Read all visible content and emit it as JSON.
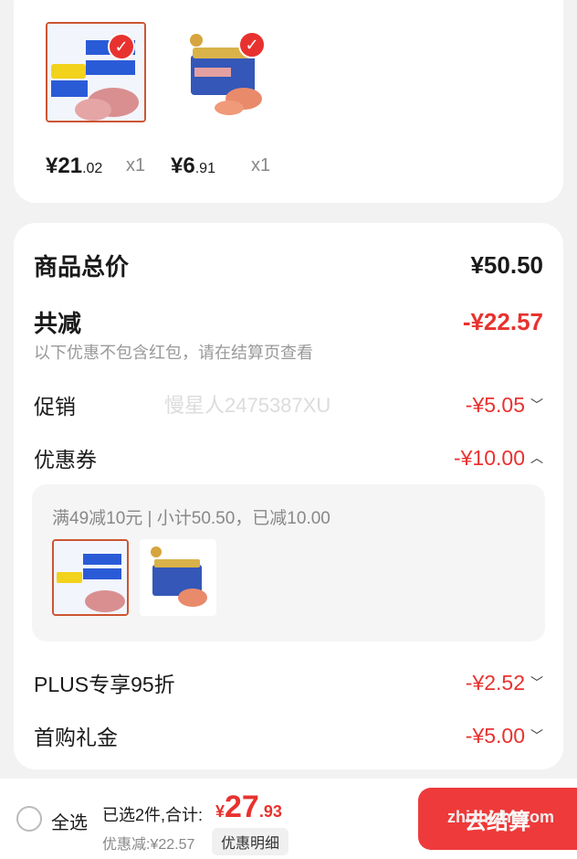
{
  "products": [
    {
      "price_int": "21",
      "price_dec": ".02",
      "currency": "¥",
      "qty": "x1"
    },
    {
      "price_int": "6",
      "price_dec": ".91",
      "currency": "¥",
      "qty": "x1"
    }
  ],
  "summary": {
    "total_label": "商品总价",
    "total_value": "¥50.50",
    "reduce_label": "共减",
    "reduce_value": "-¥22.57",
    "note": "以下优惠不包含红包，请在结算页查看",
    "promo_label": "促销",
    "promo_value": "-¥5.05",
    "coupon_label": "优惠券",
    "coupon_value": "-¥10.00",
    "coupon_detail": "满49减10元 | 小计50.50，已减10.00",
    "plus_label": "PLUS专享95折",
    "plus_value": "-¥2.52",
    "first_label": "首购礼金",
    "first_value": "-¥5.00"
  },
  "watermark": "慢星人2475387XU",
  "bottom": {
    "select_all": "全选",
    "selected": "已选2件,合计:",
    "currency": "¥",
    "total_int": "27",
    "total_dec": ".93",
    "discount": "优惠减:¥22.57",
    "detail_button": "优惠明细",
    "checkout": "去结算",
    "site": "zhizhizhi.com"
  },
  "colors": {
    "accent": "#e8322f",
    "checkout": "#ee3a3a"
  },
  "icons": [
    "check-icon",
    "chevron-down-icon",
    "chevron-up-icon",
    "radio-icon"
  ]
}
